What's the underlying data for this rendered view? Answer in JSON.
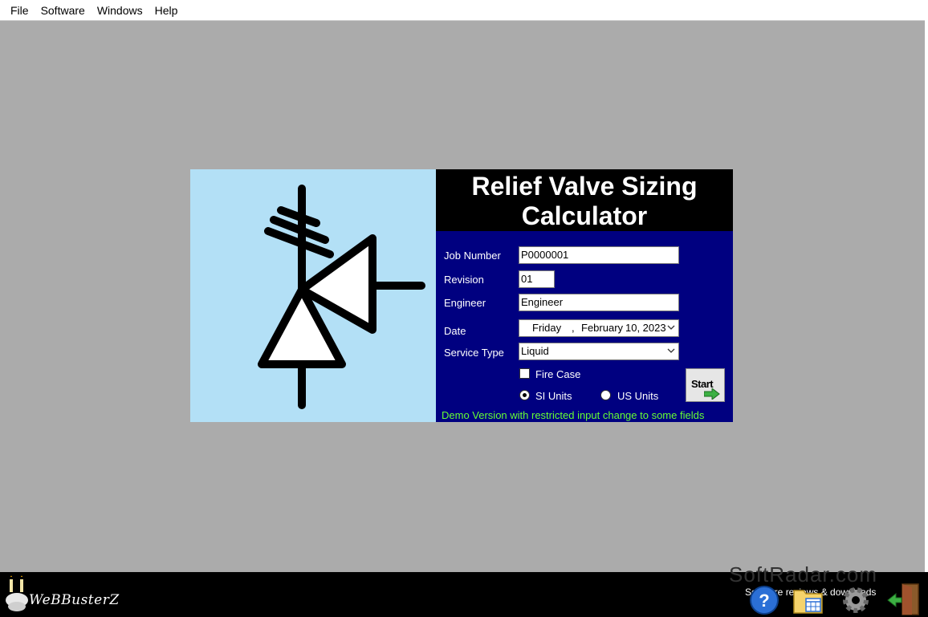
{
  "menu": [
    "File",
    "Software",
    "Windows",
    "Help"
  ],
  "title": {
    "line1": "Relief Valve Sizing",
    "line2": "Calculator"
  },
  "form": {
    "job_number_label": "Job Number",
    "job_number_value": "P0000001",
    "revision_label": "Revision",
    "revision_value": "01",
    "engineer_label": "Engineer",
    "engineer_value": "Engineer",
    "date_label": "Date",
    "date_day": "Friday",
    "date_sep": ",",
    "date_month": "February",
    "date_rest": "10, 2023",
    "service_type_label": "Service Type",
    "service_type_value": "Liquid",
    "fire_case_label": "Fire Case",
    "si_units_label": "SI Units",
    "us_units_label": "US Units",
    "start_label": "Start"
  },
  "demo_notice": "Demo Version with restricted input change to some fields",
  "taskbar": {
    "logo_text": "WeBBusterZ",
    "watermark_title": "SoftRadar.com",
    "watermark_subtitle": "Software reviews & downloads"
  },
  "icons": [
    "relief-valve-symbol-icon",
    "help-icon",
    "calendar-folder-icon",
    "gear-icon",
    "exit-door-icon",
    "chevron-down-icon"
  ],
  "colors": {
    "workspace": "#ababab",
    "icon_background": "#b3e0f6",
    "form_background": "#000080",
    "title_background": "#000000",
    "demo_text": "#66ff33"
  }
}
